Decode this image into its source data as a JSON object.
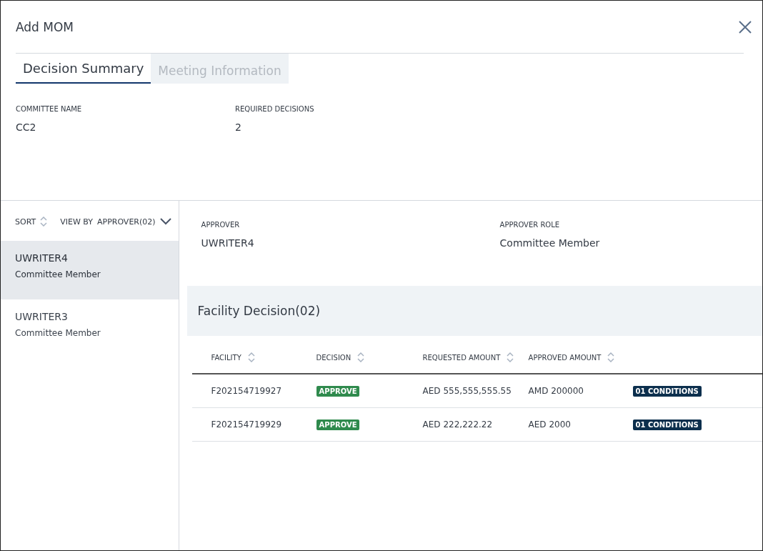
{
  "dialog": {
    "title": "Add MOM"
  },
  "tabs": [
    {
      "label": "Decision Summary",
      "selected": true
    },
    {
      "label": "Meeting Information",
      "selected": false
    }
  ],
  "summary_fields": [
    {
      "label": "COMMITTEE NAME",
      "value": "CC2"
    },
    {
      "label": "REQUIRED DECISIONS",
      "value": "2"
    }
  ],
  "list_toolbar": {
    "sort_label": "SORT",
    "view_by_label": "VIEW BY",
    "view_by_value": "APPROVER(02)"
  },
  "approvers": [
    {
      "name": "UWRITER4",
      "role": "Committee Member",
      "selected": true
    },
    {
      "name": "UWRITER3",
      "role": "Committee Member",
      "selected": false
    }
  ],
  "detail_fields": [
    {
      "label": "APPROVER",
      "value": "UWRITER4"
    },
    {
      "label": "APPROVER ROLE",
      "value": "Committee Member"
    }
  ],
  "facility_section": {
    "title": "Facility Decision(02)"
  },
  "table": {
    "columns": [
      "FACILITY",
      "DECISION",
      "REQUESTED AMOUNT",
      "APPROVED AMOUNT"
    ],
    "rows": [
      {
        "facility": "F202154719927",
        "decision": "APPROVE",
        "requested": "AED 555,555,555.55",
        "approved": "AMD 200000",
        "conditions": "01 CONDITIONS"
      },
      {
        "facility": "F202154719929",
        "decision": "APPROVE",
        "requested": "AED 222,222.22",
        "approved": "AED 2000",
        "conditions": "01 CONDITIONS"
      }
    ]
  }
}
